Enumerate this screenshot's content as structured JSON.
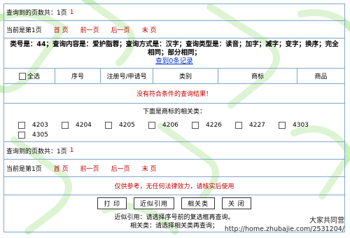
{
  "top_pager": {
    "total_pages_label": "查询到的页数共：",
    "total_pages_value": "1页",
    "total_pages_num": "1",
    "current_label": "当前是第1页",
    "first": "首 页",
    "prev": "前一页",
    "next": "后一页",
    "last": "末 页"
  },
  "query": {
    "text": "类号是：44；查询内容是：爱护脂蓉；查询方式是：汉字；查询类型是：读音；加字；减字；变字；换序；完全相同；部分相同；",
    "records_link": "查到0条记录"
  },
  "table": {
    "select_all": "全选",
    "columns": [
      "序号",
      "注册号/申请号",
      "类别",
      "商标",
      "商品"
    ]
  },
  "no_result": "没有符合条件的查询结果！",
  "related": {
    "title": "下面是商标的相关类：",
    "codes": [
      "4203",
      "4204",
      "4205",
      "4206",
      "4226",
      "4227",
      "4303",
      "4305"
    ]
  },
  "bottom_pager": {
    "total_pages_label": "查询到的页数共：",
    "total_pages_value": "1页",
    "total_pages_num": "1",
    "current_label": "当前是第1页",
    "first": "首 页",
    "prev": "前一页",
    "next": "后一页",
    "last": "末 页"
  },
  "notice": "仅供参考，无任何法律效力，请核实后使用",
  "buttons": {
    "print": "打 印",
    "similar": "近似引用",
    "related": "相关类",
    "close": "关 闭"
  },
  "help": {
    "similar": "近似引用：请选择序号前的复选框再查询。",
    "related": "相关类：请选择相关类再查询；"
  },
  "watermark": {
    "line1": "大家共同营",
    "line2": "http://home.zhubajie.com/2531204/"
  },
  "colors": {
    "border": "#7fa8c8",
    "link_red": "#c00000",
    "link_blue": "#0033cc",
    "bg_deco": "#b8e8a8"
  }
}
